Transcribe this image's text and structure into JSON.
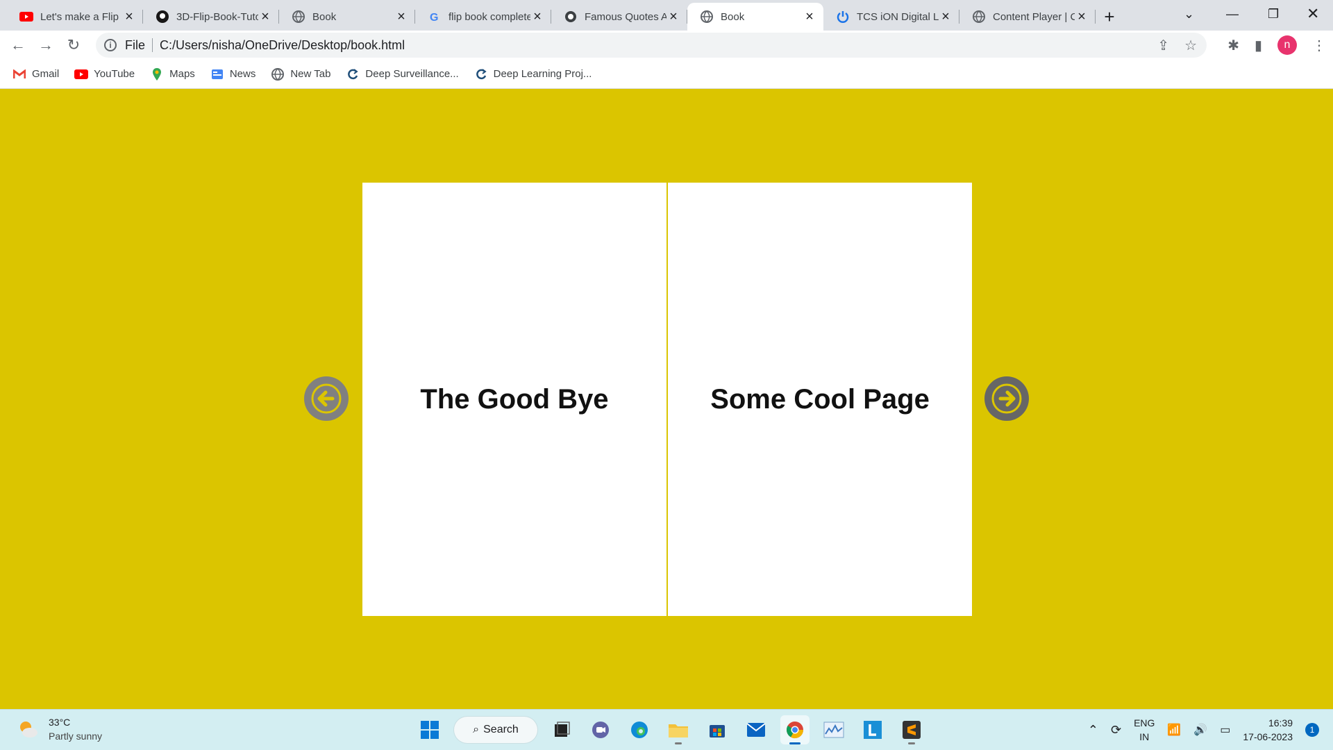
{
  "browser": {
    "tabs": [
      {
        "title": "Let's make a Flip B",
        "icon": "youtube-icon",
        "active": false
      },
      {
        "title": "3D-Flip-Book-Tuto",
        "icon": "github-icon",
        "active": false
      },
      {
        "title": "Book",
        "icon": "globe-icon",
        "active": false
      },
      {
        "title": "flip book complete",
        "icon": "google-icon",
        "active": false
      },
      {
        "title": "Famous Quotes A",
        "icon": "quotes-site-icon",
        "active": false
      },
      {
        "title": "Book",
        "icon": "globe-icon",
        "active": true
      },
      {
        "title": "TCS iON Digital Le",
        "icon": "power-icon",
        "active": false
      },
      {
        "title": "Content Player | C",
        "icon": "globe-icon",
        "active": false
      }
    ],
    "new_tab_symbol": "+",
    "address": {
      "scheme_label": "File",
      "url": "C:/Users/nisha/OneDrive/Desktop/book.html"
    },
    "profile_initial": "n",
    "bookmarks": [
      {
        "label": "Gmail",
        "icon": "gmail-icon"
      },
      {
        "label": "YouTube",
        "icon": "youtube-icon"
      },
      {
        "label": "Maps",
        "icon": "maps-icon"
      },
      {
        "label": "News",
        "icon": "news-icon"
      },
      {
        "label": "New Tab",
        "icon": "globe-icon"
      },
      {
        "label": "Deep Surveillance...",
        "icon": "refresh-logo-icon"
      },
      {
        "label": "Deep Learning Proj...",
        "icon": "refresh-logo-icon"
      }
    ]
  },
  "book": {
    "left_page": "The Good Bye",
    "right_page": "Some Cool Page"
  },
  "colors": {
    "page_background": "#dbc500",
    "page_white": "#ffffff",
    "arrow_gray": "#808080"
  },
  "taskbar": {
    "weather": {
      "temp": "33°C",
      "condition": "Partly sunny"
    },
    "search_label": "Search",
    "tray": {
      "lang_top": "ENG",
      "lang_bottom": "IN",
      "time": "16:39",
      "date": "17-06-2023",
      "notification_count": "1"
    }
  }
}
